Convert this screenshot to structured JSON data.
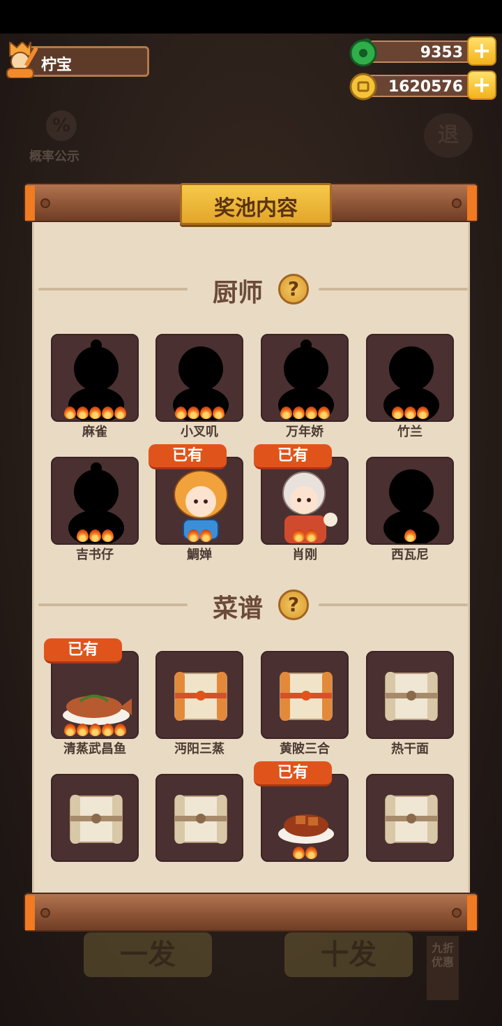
{
  "player": {
    "name": "柠宝"
  },
  "currency": {
    "jade": "9353",
    "coins": "1620576"
  },
  "background": {
    "prob_label": "概率公示",
    "exit_label": "退",
    "single_draw": "一发",
    "ten_draw": "十发",
    "discount_tag": "九折优惠"
  },
  "panel": {
    "title": "奖池内容"
  },
  "chefs": {
    "title": "厨师",
    "items": [
      {
        "name": "麻雀",
        "stars": 5,
        "owned": false
      },
      {
        "name": "小叉叽",
        "stars": 4,
        "owned": false
      },
      {
        "name": "万年娇",
        "stars": 4,
        "owned": false
      },
      {
        "name": "竹兰",
        "stars": 3,
        "owned": false
      },
      {
        "name": "吉书仔",
        "stars": 3,
        "owned": false
      },
      {
        "name": "鯛婵",
        "stars": 2,
        "owned": true
      },
      {
        "name": "肖刚",
        "stars": 2,
        "owned": true
      },
      {
        "name": "西瓦尼",
        "stars": 1,
        "owned": false
      }
    ]
  },
  "recipes": {
    "title": "菜谱",
    "items": [
      {
        "name": "清蒸武昌鱼",
        "stars": 5,
        "owned": true
      },
      {
        "name": "沔阳三蒸",
        "stars": 0,
        "owned": false
      },
      {
        "name": "黄陂三合",
        "stars": 0,
        "owned": false
      },
      {
        "name": "热干面",
        "stars": 0,
        "owned": false
      },
      {
        "name": "",
        "stars": 0,
        "owned": false
      },
      {
        "name": "",
        "stars": 0,
        "owned": false
      },
      {
        "name": "",
        "stars": 2,
        "owned": true
      },
      {
        "name": "",
        "stars": 0,
        "owned": false
      }
    ]
  },
  "labels": {
    "owned": "已有",
    "help": "?",
    "plus": "+"
  }
}
